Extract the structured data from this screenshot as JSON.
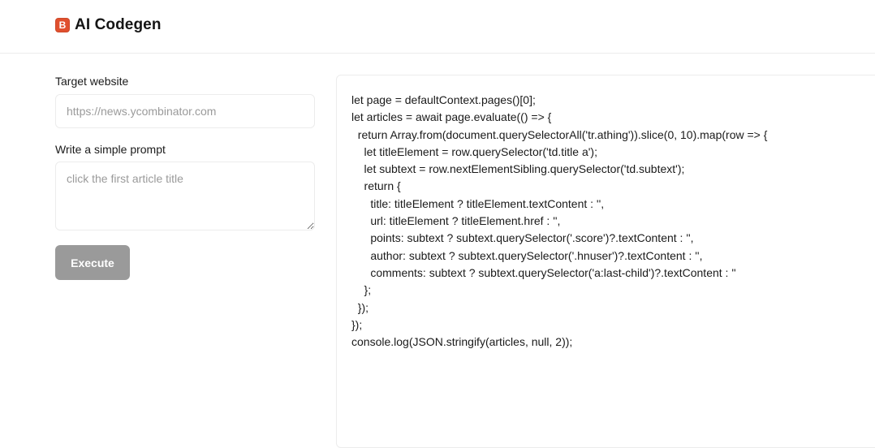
{
  "header": {
    "logo_letter": "B",
    "title": "AI Codegen"
  },
  "form": {
    "target_label": "Target website",
    "target_placeholder": "https://news.ycombinator.com",
    "prompt_label": "Write a simple prompt",
    "prompt_placeholder": "click the first article title",
    "execute_label": "Execute"
  },
  "code": {
    "lines": [
      "let page = defaultContext.pages()[0];",
      "let articles = await page.evaluate(() => {",
      "  return Array.from(document.querySelectorAll('tr.athing')).slice(0, 10).map(row => {",
      "    let titleElement = row.querySelector('td.title a');",
      "    let subtext = row.nextElementSibling.querySelector('td.subtext');",
      "    return {",
      "      title: titleElement ? titleElement.textContent : '',",
      "      url: titleElement ? titleElement.href : '',",
      "      points: subtext ? subtext.querySelector('.score')?.textContent : '',",
      "      author: subtext ? subtext.querySelector('.hnuser')?.textContent : '',",
      "      comments: subtext ? subtext.querySelector('a:last-child')?.textContent : ''",
      "    };",
      "  });",
      "});",
      "console.log(JSON.stringify(articles, null, 2));"
    ]
  },
  "colors": {
    "logo": "#e0502e",
    "button": "#9a9a9a",
    "border": "#ececec"
  }
}
